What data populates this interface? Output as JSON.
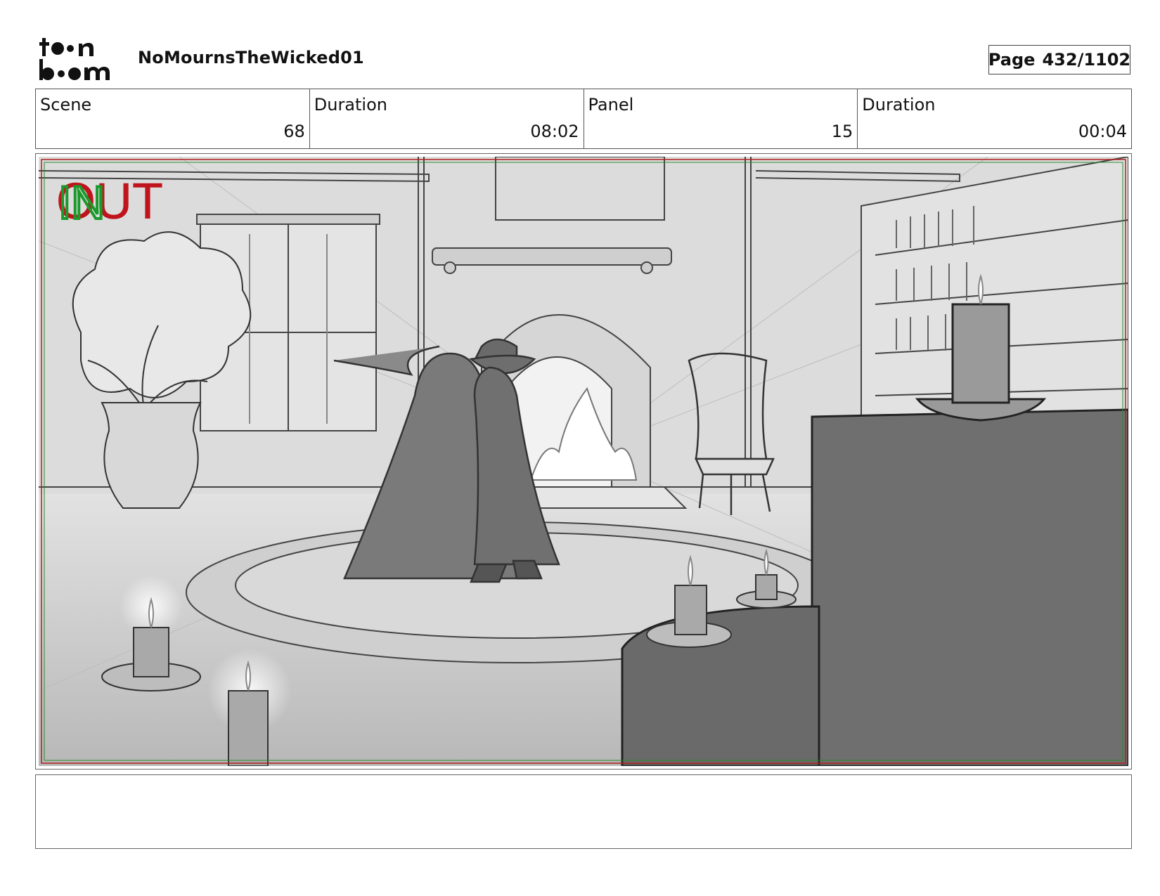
{
  "header": {
    "logo": {
      "name": "toonboom-logo",
      "line1": "toon",
      "line2": "boom"
    },
    "project_title": "NoMournsTheWicked01",
    "page_label": "Page",
    "page_number": "432/1102"
  },
  "info": {
    "scene_label": "Scene",
    "scene_value": "68",
    "scene_duration_label": "Duration",
    "scene_duration_value": "08:02",
    "panel_label": "Panel",
    "panel_value": "15",
    "panel_duration_label": "Duration",
    "panel_duration_value": "00:04"
  },
  "panel": {
    "overlay_in": "IN",
    "overlay_out": "OUT",
    "colors": {
      "in": "#1a9a2a",
      "out": "#c0141c",
      "safe_frame_red": "#b02020",
      "safe_frame_green": "#2a8a2a"
    }
  },
  "notes": {
    "text": ""
  }
}
